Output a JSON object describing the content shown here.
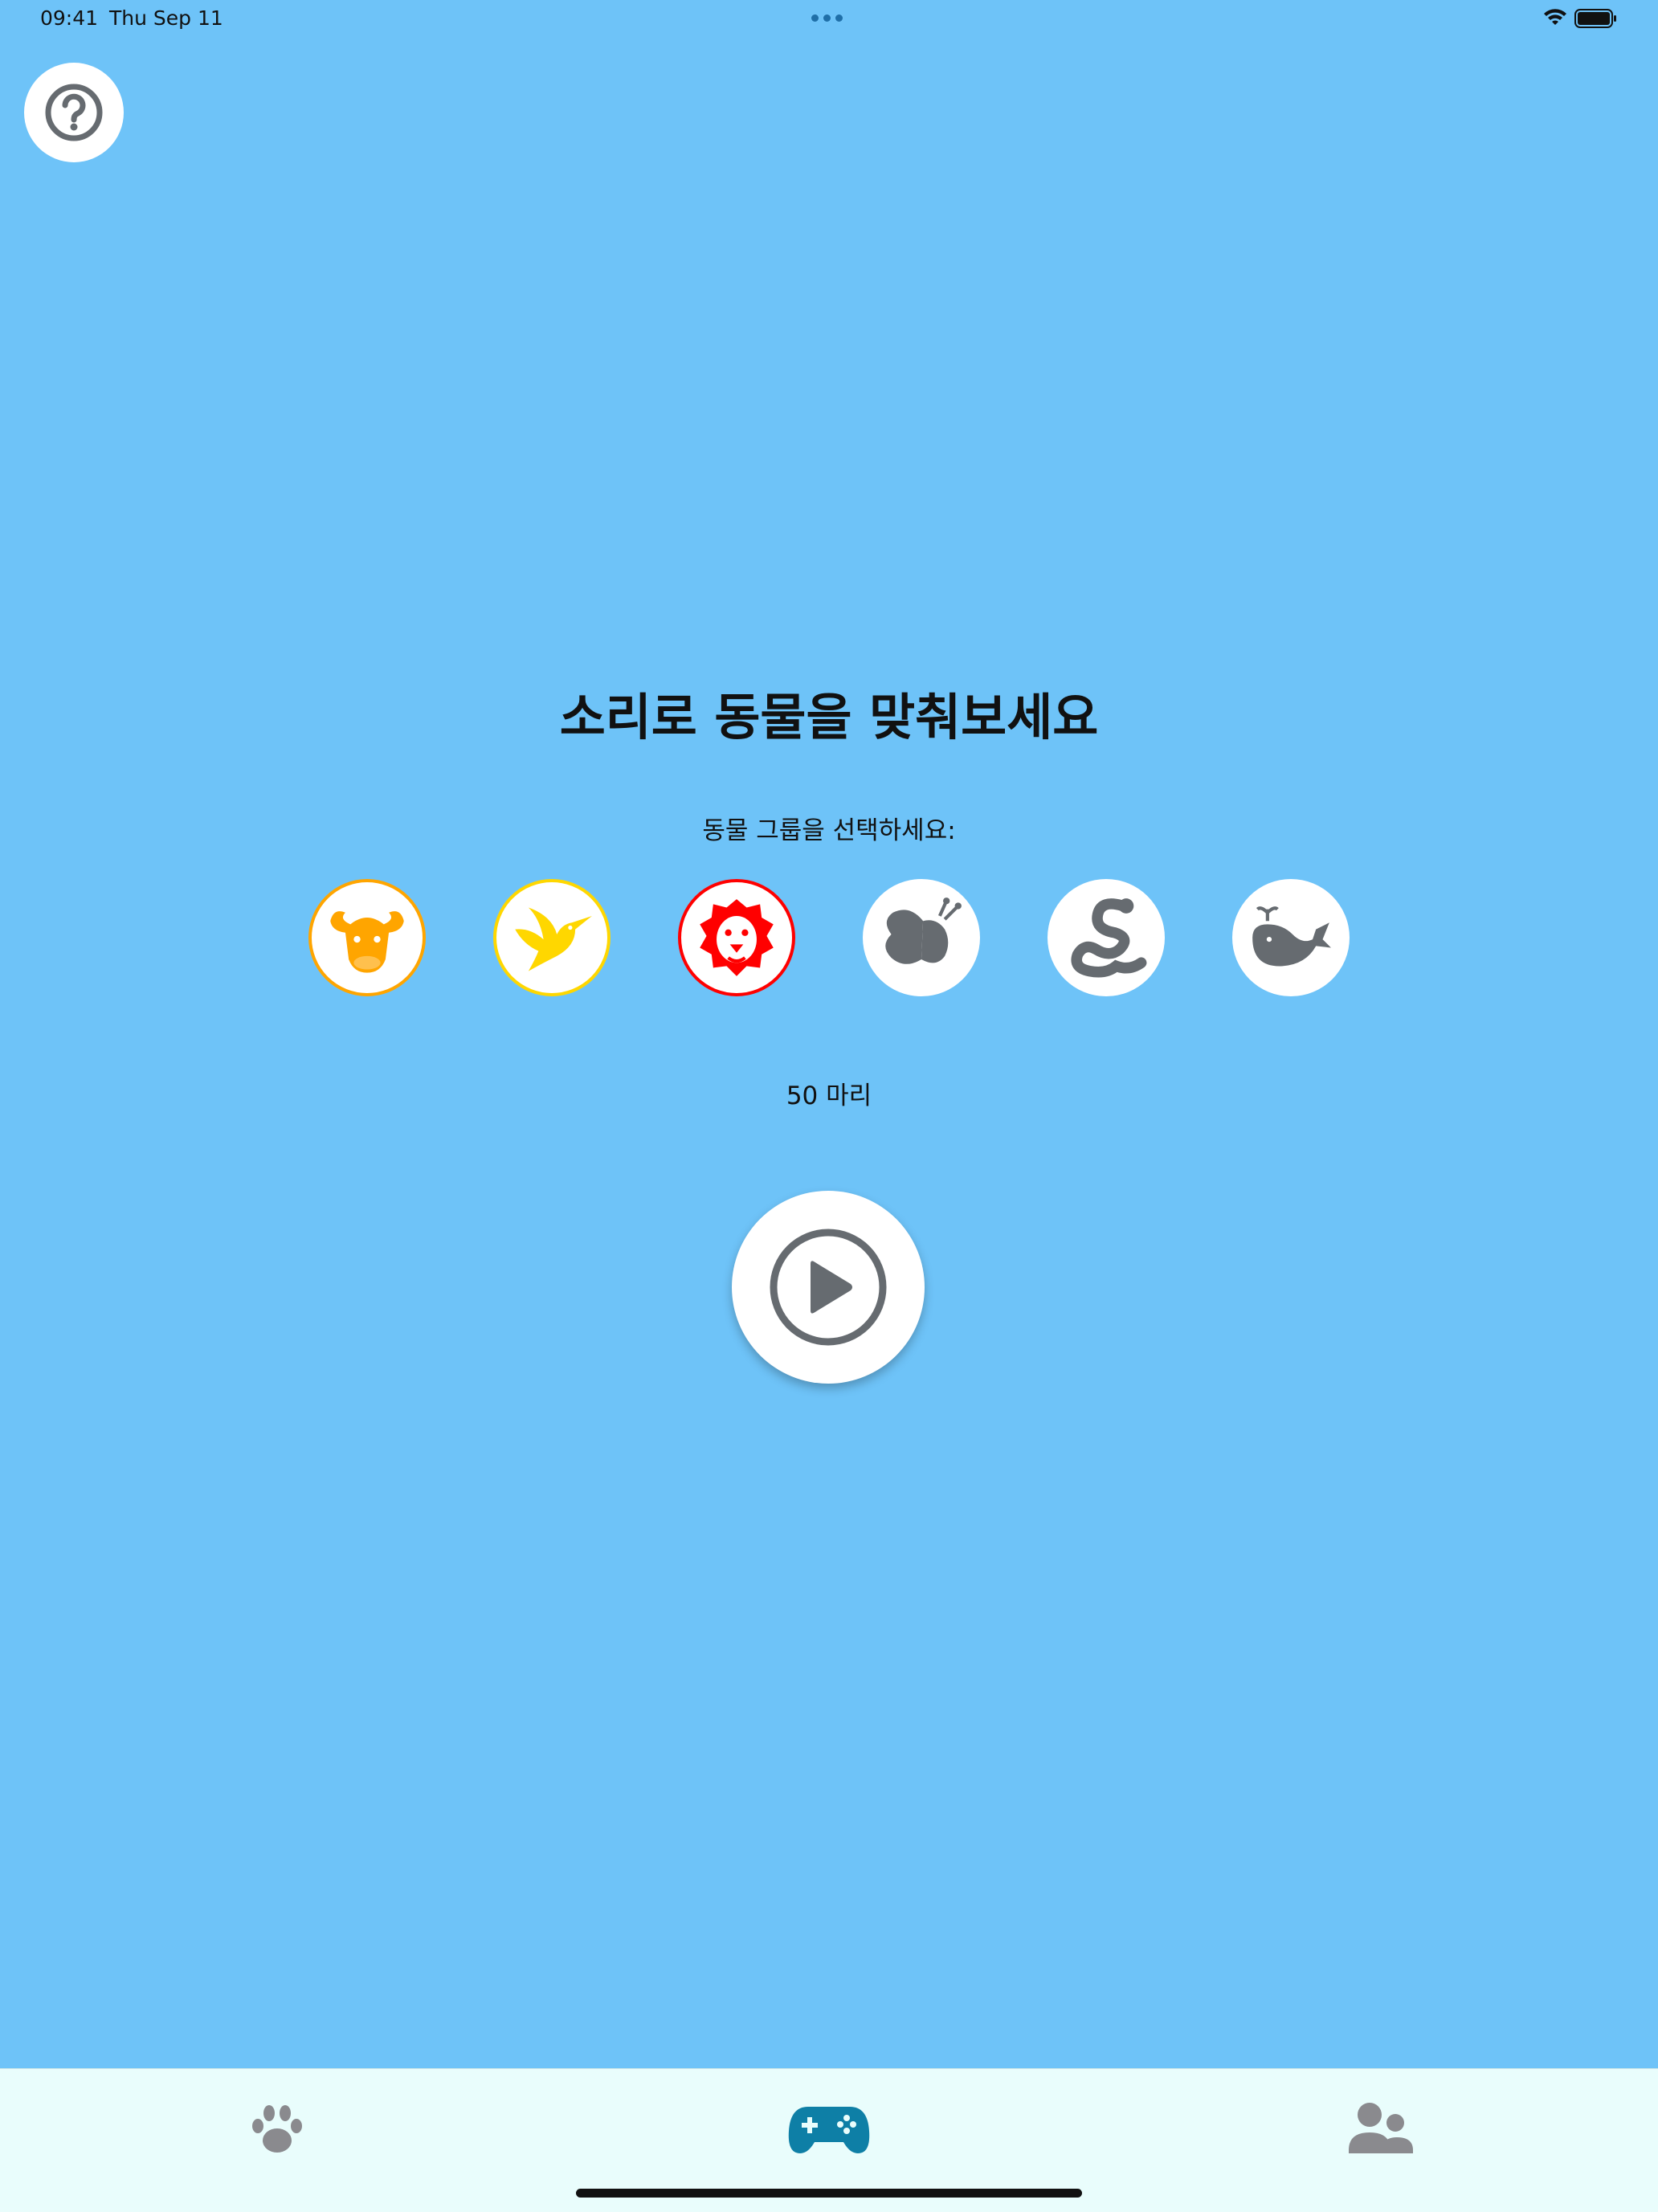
{
  "status_bar": {
    "time": "09:41",
    "date": "Thu Sep 11",
    "wifi_icon": "wifi-icon",
    "battery_icon": "battery-icon"
  },
  "help": {
    "icon": "question-circle-icon"
  },
  "main": {
    "title": "소리로 동물을 맞춰보세요",
    "group_prompt": "동물 그룹을 선택하세요:",
    "groups": [
      {
        "id": "mammals",
        "icon": "cow-icon",
        "selected": true,
        "color": "#ffa500"
      },
      {
        "id": "birds",
        "icon": "bird-icon",
        "selected": true,
        "color": "#ffd700"
      },
      {
        "id": "wild",
        "icon": "lion-icon",
        "selected": true,
        "color": "#ff0000"
      },
      {
        "id": "insects",
        "icon": "butterfly-icon",
        "selected": false,
        "color": "#666b70"
      },
      {
        "id": "reptiles",
        "icon": "snake-icon",
        "selected": false,
        "color": "#666b70"
      },
      {
        "id": "sea",
        "icon": "whale-icon",
        "selected": false,
        "color": "#666b70"
      }
    ],
    "count_label": "50 마리",
    "play_icon": "play-circle-icon"
  },
  "tab_bar": {
    "tabs": [
      {
        "id": "animals",
        "icon": "paw-icon",
        "active": false
      },
      {
        "id": "game",
        "icon": "gamepad-icon",
        "active": true
      },
      {
        "id": "profile",
        "icon": "users-icon",
        "active": false
      }
    ],
    "active_color": "#0e7fa6",
    "inactive_color": "#8a8a8e"
  },
  "colors": {
    "background": "#6ec3f8",
    "icon_gray": "#666b70"
  }
}
